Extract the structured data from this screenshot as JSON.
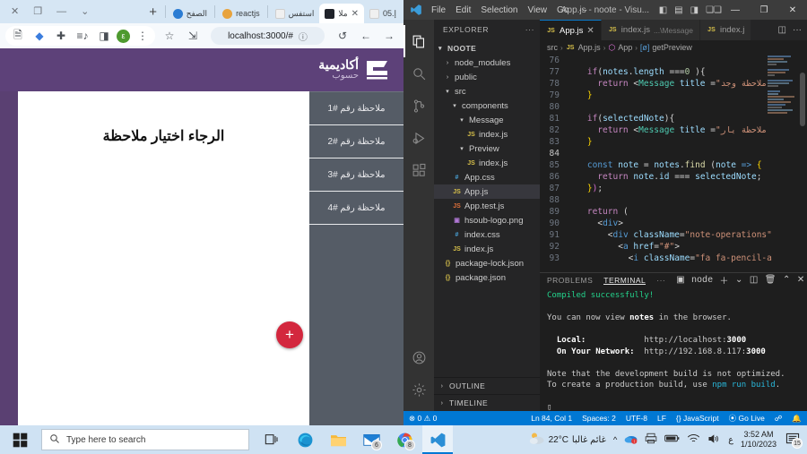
{
  "browser": {
    "window_controls": [
      "✕",
      "❐",
      "—",
      "⌄"
    ],
    "tabs": [
      {
        "label": "إ.05",
        "icon": "hsoub-icon",
        "active": false
      },
      {
        "label": "ملا",
        "icon": "react-icon",
        "active": true,
        "close": "✕"
      },
      {
        "label": "استفس",
        "icon": "hsoub-icon",
        "active": false
      },
      {
        "label": "reactjs",
        "icon": "firefox-icon",
        "active": false
      },
      {
        "label": "الصفح",
        "icon": "edge-icon",
        "active": false
      }
    ],
    "new_tab_label": "+",
    "toolbar": {
      "back": "←",
      "forward": "→",
      "reload": "↺",
      "info": "ⓘ",
      "url": "localhost:3000/#",
      "collections": "⇲",
      "favorite": "☆",
      "readaloud": "🗎",
      "split": "◆",
      "extensions": "✚",
      "playlist": "≡♪",
      "sidebar": "◨",
      "profile_initial": "ε",
      "more": "⋮"
    },
    "page": {
      "logo_title": "أكاديمية",
      "logo_subtitle": "حسوب",
      "notes": [
        {
          "label": "ملاحظة رقم #1"
        },
        {
          "label": "ملاحظة رقم #2"
        },
        {
          "label": "ملاحظة رقم #3"
        },
        {
          "label": "ملاحظة رقم #4"
        }
      ],
      "empty_message": "الرجاء اختيار ملاحظة",
      "add_button": "+"
    }
  },
  "vscode": {
    "titlebar": {
      "menus": [
        "File",
        "Edit",
        "Selection",
        "View",
        "Go",
        "···"
      ],
      "title": "App.js - noote - Visu...",
      "layout_icons": [
        "panel-left-icon",
        "panel-bottom-icon",
        "panel-right-icon",
        "layout-grid-icon"
      ],
      "window_controls": [
        "—",
        "❐",
        "✕"
      ]
    },
    "activity_bar": [
      {
        "name": "explorer-icon",
        "glyph": "files",
        "active": true
      },
      {
        "name": "search-icon",
        "glyph": "search",
        "active": false
      },
      {
        "name": "source-control-icon",
        "glyph": "branch",
        "active": false
      },
      {
        "name": "run-debug-icon",
        "glyph": "play",
        "active": false
      },
      {
        "name": "extensions-icon",
        "glyph": "blocks",
        "active": false
      },
      {
        "name": "account-icon",
        "glyph": "person",
        "active": false
      },
      {
        "name": "settings-icon",
        "glyph": "gear",
        "active": false
      }
    ],
    "sidebar": {
      "title": "EXPLORER",
      "more": "···",
      "root": "NOOTE",
      "tree": [
        {
          "label": "node_modules",
          "indent": 1,
          "type": "folder",
          "open": false
        },
        {
          "label": "public",
          "indent": 1,
          "type": "folder",
          "open": false
        },
        {
          "label": "src",
          "indent": 1,
          "type": "folder",
          "open": true
        },
        {
          "label": "components",
          "indent": 2,
          "type": "folder",
          "open": true
        },
        {
          "label": "Message",
          "indent": 3,
          "type": "folder",
          "open": true
        },
        {
          "label": "index.js",
          "indent": 4,
          "type": "js"
        },
        {
          "label": "Preview",
          "indent": 3,
          "type": "folder",
          "open": true
        },
        {
          "label": "index.js",
          "indent": 4,
          "type": "js"
        },
        {
          "label": "App.css",
          "indent": 2,
          "type": "css"
        },
        {
          "label": "App.js",
          "indent": 2,
          "type": "js",
          "selected": true
        },
        {
          "label": "App.test.js",
          "indent": 2,
          "type": "jsr"
        },
        {
          "label": "hsoub-logo.png",
          "indent": 2,
          "type": "png"
        },
        {
          "label": "index.css",
          "indent": 2,
          "type": "css"
        },
        {
          "label": "index.js",
          "indent": 2,
          "type": "js"
        },
        {
          "label": "package-lock.json",
          "indent": 1,
          "type": "json"
        },
        {
          "label": "package.json",
          "indent": 1,
          "type": "json"
        }
      ],
      "sections": [
        "OUTLINE",
        "TIMELINE"
      ]
    },
    "editor_tabs": [
      {
        "label": "App.js",
        "sub": "",
        "type": "js",
        "active": true,
        "close": "✕"
      },
      {
        "label": "index.js",
        "sub": "...\\Message",
        "type": "js",
        "active": false
      },
      {
        "label": "index.j",
        "sub": "",
        "type": "js",
        "active": false
      }
    ],
    "tab_actions": [
      "split-editor-icon",
      "more-actions-icon"
    ],
    "breadcrumb": [
      "src",
      "App.js",
      "App",
      "getPreview"
    ],
    "code_lines": [
      {
        "n": "76",
        "text": ""
      },
      {
        "n": "77",
        "text": "    if(notes.length ===0 ){"
      },
      {
        "n": "78",
        "text": "      return <Message title =\"وجد ملاحظة"
      },
      {
        "n": "79",
        "text": "    }"
      },
      {
        "n": "80",
        "text": ""
      },
      {
        "n": "81",
        "text": "    if(selectedNote){"
      },
      {
        "n": "82",
        "text": "      return <Message title =\"يار ملاحظة"
      },
      {
        "n": "83",
        "text": "    }"
      },
      {
        "n": "84",
        "text": "",
        "current": true
      },
      {
        "n": "85",
        "text": "    const note = notes.find (note => {"
      },
      {
        "n": "86",
        "text": "      return note.id === selectedNote;"
      },
      {
        "n": "87",
        "text": "    });"
      },
      {
        "n": "88",
        "text": ""
      },
      {
        "n": "89",
        "text": "    return ("
      },
      {
        "n": "90",
        "text": "      <div>"
      },
      {
        "n": "91",
        "text": "        <div className=\"note-operations\""
      },
      {
        "n": "92",
        "text": "          <a href=\"#\">"
      },
      {
        "n": "93",
        "text": "            <i className=\"fa fa-pencil-a"
      }
    ],
    "panel": {
      "tabs": [
        "PROBLEMS",
        "TERMINAL"
      ],
      "active_tab": "TERMINAL",
      "more": "···",
      "shell_label": "node",
      "actions": [
        "new-terminal-icon",
        "dropdown-icon",
        "split-terminal-icon",
        "kill-terminal-icon",
        "chevron-up-icon",
        "close-icon"
      ],
      "terminal_lines": [
        {
          "text": "Compiled successfully!",
          "cls": "tgreen"
        },
        {
          "text": ""
        },
        {
          "text": "You can now view notes in the browser."
        },
        {
          "text": ""
        },
        {
          "text": "  Local:            http://localhost:3000"
        },
        {
          "text": "  On Your Network:  http://192.168.8.117:3000"
        },
        {
          "text": ""
        },
        {
          "text": "Note that the development build is not optimized."
        },
        {
          "text": "To create a production build, use npm run build."
        },
        {
          "text": ""
        },
        {
          "text": "▯"
        }
      ]
    },
    "statusbar": {
      "errors": "0",
      "warnings": "0",
      "position": "Ln 84, Col 1",
      "spaces": "Spaces: 2",
      "encoding": "UTF-8",
      "eol": "LF",
      "language": "JavaScript",
      "golive": "Go Live",
      "feedback_icon": "feedback-icon",
      "bell_icon": "bell-icon"
    }
  },
  "taskbar": {
    "start_label": "start-icon",
    "search_placeholder": "Type here to search",
    "apps": [
      {
        "name": "task-view-icon"
      },
      {
        "name": "edge-icon"
      },
      {
        "name": "file-explorer-icon"
      },
      {
        "name": "mail-icon",
        "badge": "6"
      },
      {
        "name": "chrome-icon",
        "badge": "8"
      },
      {
        "name": "vscode-icon",
        "active": true
      }
    ],
    "tray": {
      "weather_temp": "22°C",
      "weather_desc": "غائم غالبا",
      "chevron": "^",
      "icons": [
        "onedrive-icon",
        "printer-icon",
        "battery-icon",
        "wifi-icon",
        "volume-icon"
      ],
      "lang": "ع",
      "time": "3:52 AM",
      "date": "1/10/2023",
      "notification_count": "15"
    }
  }
}
